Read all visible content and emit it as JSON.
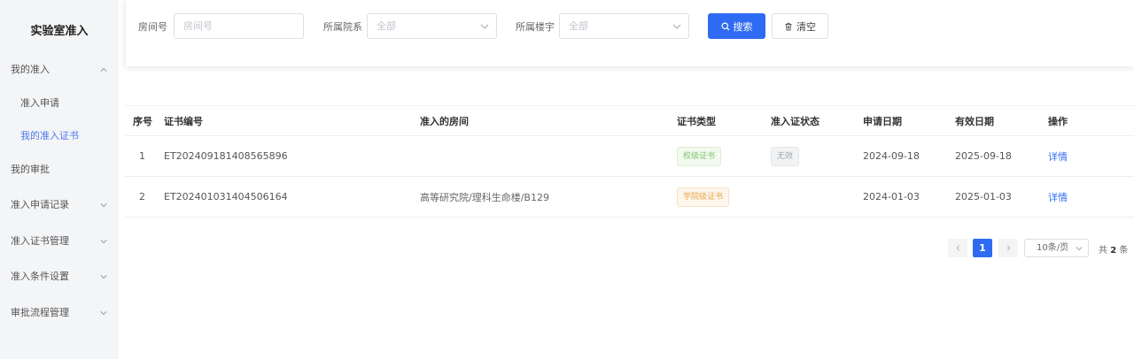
{
  "sidebar": {
    "brand": "实验室准入",
    "items": [
      {
        "label": "我的准入",
        "chevron": "up"
      },
      {
        "label": "准入申请"
      },
      {
        "label": "我的准入证书",
        "active": true
      },
      {
        "label": "我的审批"
      },
      {
        "label": "准入申请记录",
        "chevron": "down"
      },
      {
        "label": "准入证书管理",
        "chevron": "down"
      },
      {
        "label": "准入条件设置",
        "chevron": "down"
      },
      {
        "label": "审批流程管理",
        "chevron": "down"
      }
    ]
  },
  "search": {
    "room_label": "房间号",
    "room_placeholder": "房间号",
    "college_label": "所属院系",
    "college_value": "全部",
    "building_label": "所属楼宇",
    "building_value": "全部",
    "search_button": "搜索",
    "clear_button": "清空"
  },
  "table": {
    "columns": [
      "序号",
      "证书编号",
      "准入的房间",
      "证书类型",
      "准入证状态",
      "申请日期",
      "有效日期",
      "操作"
    ],
    "rows": [
      {
        "index": "1",
        "cert_no": "ET202409181408565896",
        "room": "",
        "type": "校级证书",
        "status": "无效",
        "apply_date": "2024-09-18",
        "valid_date": "2025-09-18",
        "action": "详情"
      },
      {
        "index": "2",
        "cert_no": "ET202401031404506164",
        "room": "高等研究院/理科生命楼/B129",
        "type": "学院级证书",
        "status": "",
        "apply_date": "2024-01-03",
        "valid_date": "2025-01-03",
        "action": "详情"
      }
    ]
  },
  "pagination": {
    "current_page": "1",
    "page_size": "10条/页",
    "total_prefix": "共",
    "total_count": "2",
    "total_suffix": "条"
  },
  "colors": {
    "primary": "#2f6bf2",
    "active_menu": "#4a78ec",
    "tag_green": "#7fc46a",
    "tag_orange": "#eaa64a"
  }
}
